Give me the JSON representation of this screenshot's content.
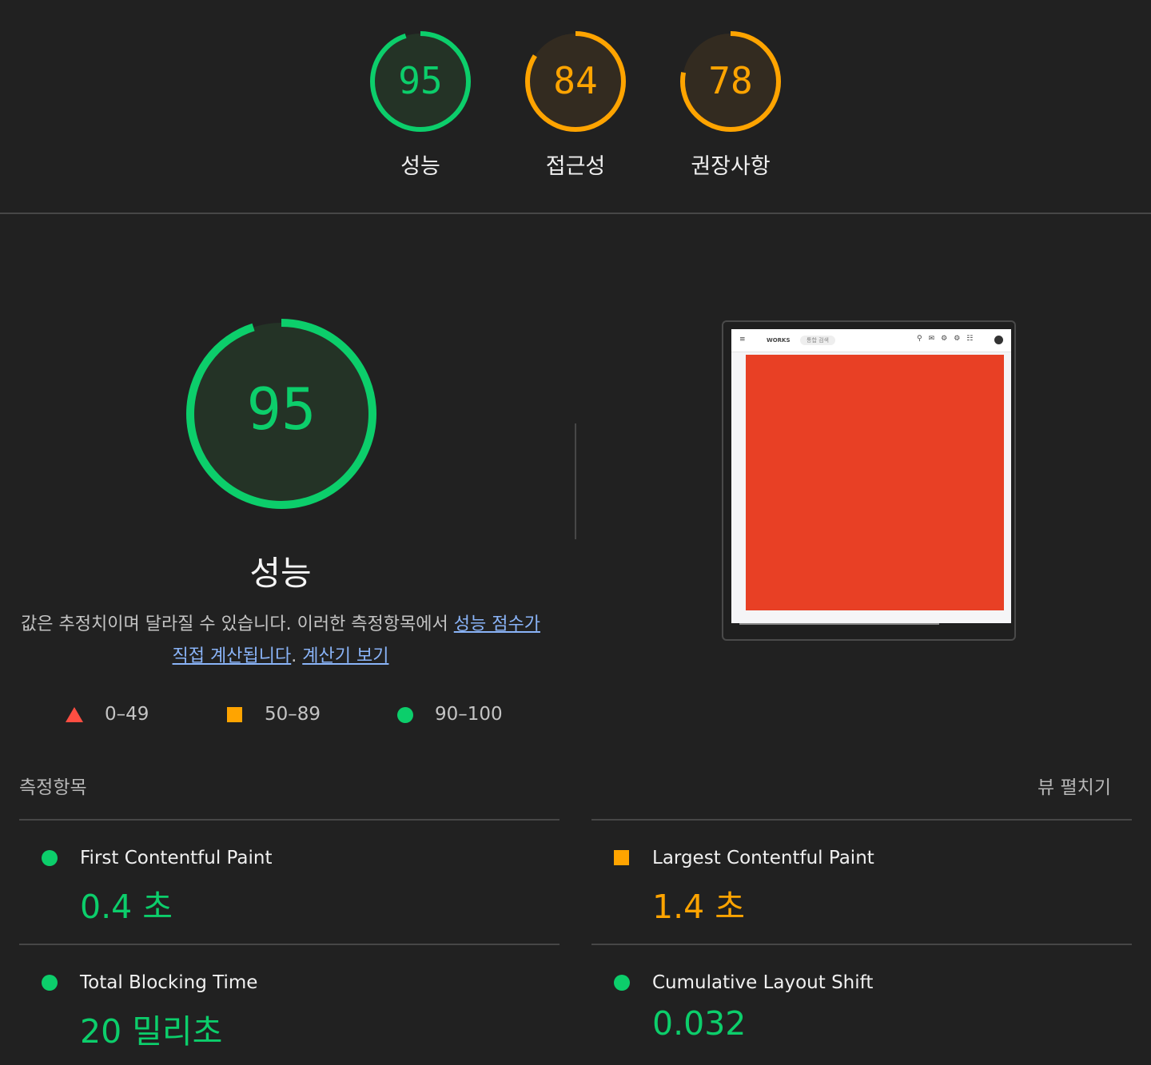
{
  "colors": {
    "pass": "#0cce6b",
    "average": "#ffa400",
    "fail": "#ff4e42",
    "link": "#8ab4f8"
  },
  "categories": [
    {
      "label": "성능",
      "score": 95,
      "status": "pass"
    },
    {
      "label": "접근성",
      "score": 84,
      "status": "average"
    },
    {
      "label": "권장사항",
      "score": 78,
      "status": "average"
    }
  ],
  "performance": {
    "score": 95,
    "label": "성능",
    "description_prefix": "값은 추정치이며 달라질 수 있습니다. 이러한 측정항목에서 ",
    "description_link1": "성능 점수가 직접 계산됩니다",
    "description_mid": ". ",
    "description_link2": "계산기 보기"
  },
  "legend": [
    {
      "range": "0–49",
      "icon": "triangle-icon"
    },
    {
      "range": "50–89",
      "icon": "square-icon"
    },
    {
      "range": "90–100",
      "icon": "circle-icon"
    }
  ],
  "screenshot": {
    "brand": "WORKS",
    "search_placeholder": "통합 검색"
  },
  "metrics_header": {
    "title": "측정항목",
    "expand_label": "뷰 펼치기"
  },
  "metrics": [
    {
      "name": "First Contentful Paint",
      "value": "0.4 초",
      "status": "pass"
    },
    {
      "name": "Largest Contentful Paint",
      "value": "1.4 초",
      "status": "average"
    },
    {
      "name": "Total Blocking Time",
      "value": "20 밀리초",
      "status": "pass"
    },
    {
      "name": "Cumulative Layout Shift",
      "value": "0.032",
      "status": "pass"
    }
  ]
}
